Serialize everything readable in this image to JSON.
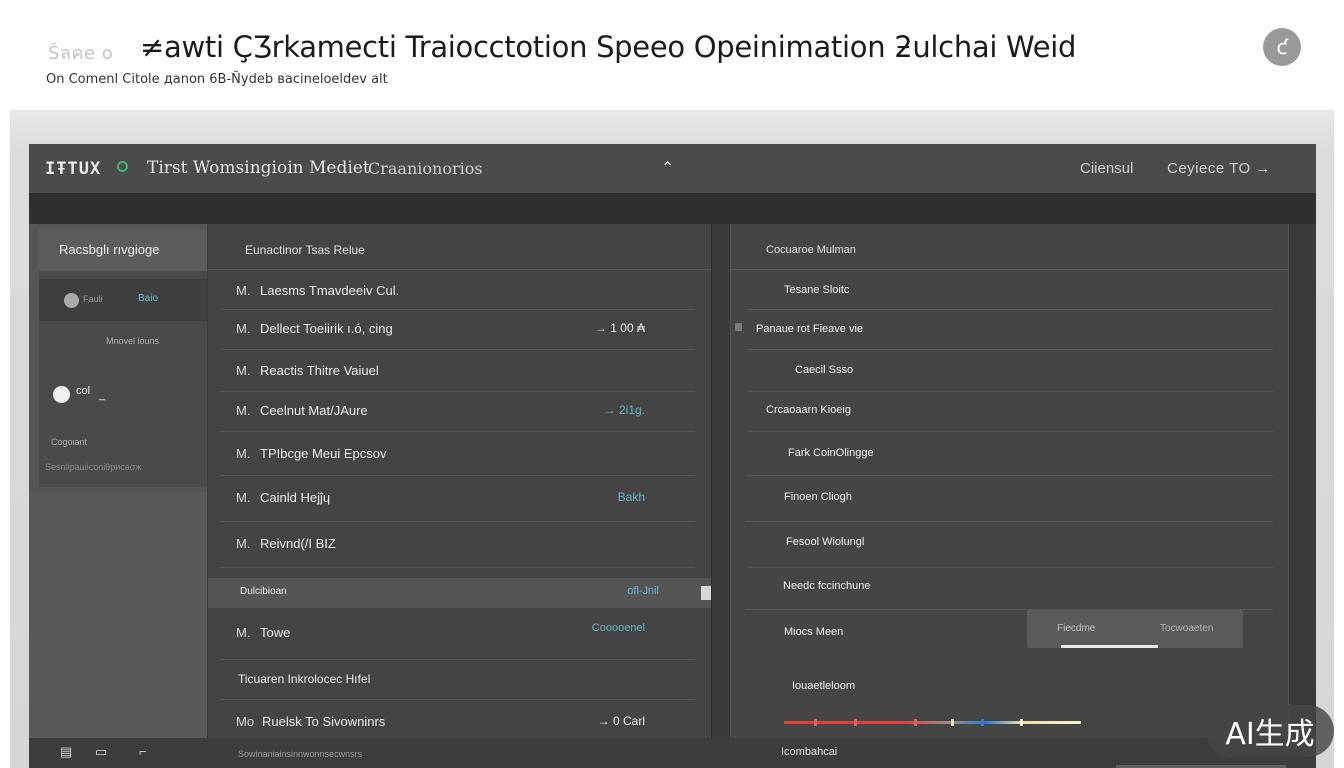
{
  "header": {
    "eyebrow": "Šลคе о",
    "title": "≠awti ÇƷrkamecti Traiocctotion Speeo Opeinimation ƻulchai Weid",
    "subtitle": "On Comenl Citole дanon 6B-Ñydeb вacineloeldev аlt",
    "avatar_glyph": "ƈ"
  },
  "app": {
    "logo": "IŦTUX",
    "title": "Tirst Womsingioin Mediet",
    "subtitle": "Craanionorios",
    "collapse_glyph": "⌃",
    "nav": [
      "Ciiensul",
      "Ceyiece  TO  →"
    ]
  },
  "sidebar": {
    "header": "Racsbglı rıvgioge",
    "toggle_off": "Fauli",
    "toggle_on": "Baio",
    "meta": "Mnovel  louns",
    "radio_label": "col",
    "cursor": "_",
    "section_label": "Cogoιant",
    "footer": "Sesnlipaшiconіθрисаσж"
  },
  "list": {
    "header": "Eunactinor  Tsas Relue",
    "rows": [
      {
        "prefix": "M.",
        "label": "Laesms  Tmavdeeiv  Cul.",
        "value": ""
      },
      {
        "prefix": "M.",
        "label": "Dellect  Toeiirik  ı.ó,  cing",
        "value": "→ 1 00 ₳"
      },
      {
        "prefix": "M.",
        "label": "Reactis  Thitre  Vaiuel",
        "value": ""
      },
      {
        "prefix": "M.",
        "label": "Ceelnut  Mat/JAure",
        "value": "→  2i1g."
      },
      {
        "prefix": "M.",
        "label": "TPIbcge  Meui   Epcsov",
        "value": ""
      },
      {
        "prefix": "M.",
        "label": "Cainld  Hejĵɥ",
        "value": "Bakh"
      },
      {
        "prefix": "M.",
        "label": "Reivnd(/I BIZ",
        "value": ""
      },
      {
        "prefix": "",
        "label": "Dulcibioan",
        "value": "ofl-Jnil"
      },
      {
        "prefix": "M.",
        "label": "Towe",
        "value": "Cooooenel"
      },
      {
        "prefix": "",
        "label": "Ticuaren  Inkrolocec  Hıfel",
        "value": ""
      },
      {
        "prefix": "Mo",
        "label": "Ruelsk  To  Sivowninrs",
        "value": "→ 0 Carl"
      }
    ]
  },
  "panel": {
    "header": "Cocuaroe  Mulman",
    "rows": [
      "Tesane Sloitc",
      "Panaue rot Fieave  vie",
      "Caecil Ssso",
      "Crcaoaarn  Kioeig",
      "Fark  CoinOlingge",
      "Finoen Cliogh",
      "Fesool Wiolungl",
      "Needc  fccinchune",
      "Miocs  Meen",
      "Iouaetleloom"
    ],
    "segment": [
      "Fiecdme",
      "Tocwoaeten"
    ]
  },
  "bottombar": {
    "icons": [
      "list-icon",
      "window-icon",
      "bracket-icon"
    ]
  },
  "footer": {
    "left": "Sowinaniainsinnwonnsecwnsrs",
    "right": "Icombahcai"
  },
  "watermark": "AI生成"
}
